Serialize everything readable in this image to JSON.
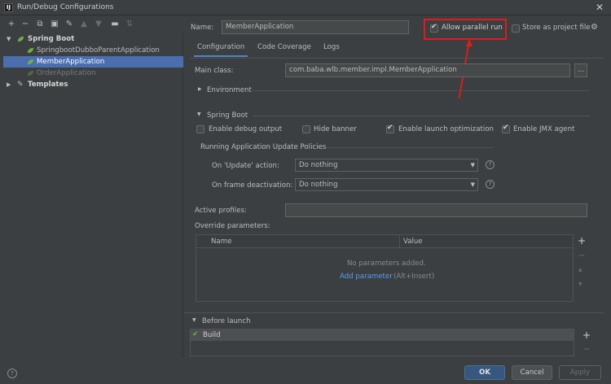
{
  "window": {
    "title": "Run/Debug Configurations",
    "app_icon_label": "IJ"
  },
  "tree": {
    "group": "Spring Boot",
    "items": [
      "SpringbootDubboParentApplication",
      "MemberApplication",
      "OrderApplication"
    ],
    "templates": "Templates"
  },
  "header": {
    "name_label": "Name:",
    "name_value": "MemberApplication",
    "allow_parallel_label": "Allow parallel run",
    "store_project_label": "Store as project file"
  },
  "tabs": [
    "Configuration",
    "Code Coverage",
    "Logs"
  ],
  "config": {
    "main_class_label": "Main class:",
    "main_class_value": "com.baba.wlb.member.impl.MemberApplication",
    "browse": "...",
    "environment": "Environment",
    "spring_boot": "Spring Boot",
    "enable_debug": "Enable debug output",
    "hide_banner": "Hide banner",
    "enable_launch": "Enable launch optimization",
    "enable_jmx": "Enable JMX agent",
    "policies_title": "Running Application Update Policies",
    "on_update_label": "On 'Update' action:",
    "on_update_value": "Do nothing",
    "on_frame_label": "On frame deactivation:",
    "on_frame_value": "Do nothing",
    "help": "?",
    "active_profiles_label": "Active profiles:",
    "override_label": "Override parameters:"
  },
  "table": {
    "col_name": "Name",
    "col_value": "Value",
    "empty": "No parameters added.",
    "add_link": "Add parameter",
    "add_hint": "(Alt+Insert)"
  },
  "before_launch": {
    "title": "Before launch",
    "task": "Build"
  },
  "buttons": {
    "ok": "OK",
    "cancel": "Cancel",
    "apply": "Apply",
    "help": "?"
  },
  "colors": {
    "selection": "#4b6eaf",
    "ok": "#365880",
    "annotation": "#e01b1b",
    "link": "#589df6"
  }
}
